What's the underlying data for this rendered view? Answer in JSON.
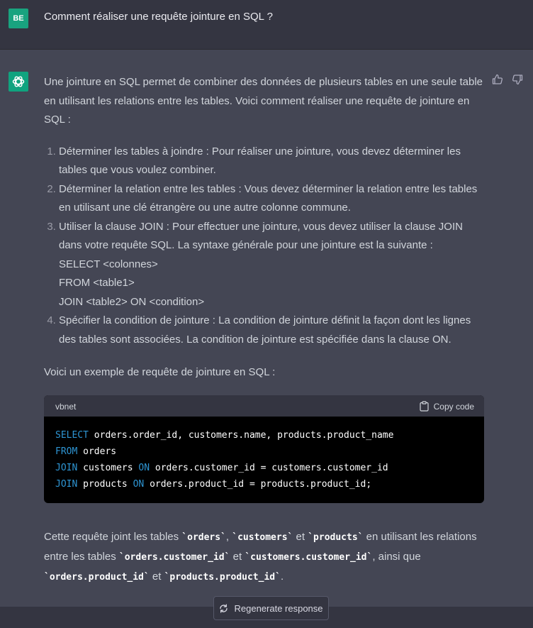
{
  "user": {
    "avatar_initials": "BE",
    "message": "Comment réaliser une requête jointure en SQL ?"
  },
  "assistant": {
    "intro": "Une jointure en SQL permet de combiner des données de plusieurs tables en une seule table en utilisant les relations entre les tables. Voici comment réaliser une requête de jointure en SQL :",
    "steps": [
      "Déterminer les tables à joindre : Pour réaliser une jointure, vous devez déterminer les tables que vous voulez combiner.",
      "Déterminer la relation entre les tables : Vous devez déterminer la relation entre les tables en utilisant une clé étrangère ou une autre colonne commune.",
      "Utiliser la clause JOIN : Pour effectuer une jointure, vous devez utiliser la clause JOIN dans votre requête SQL. La syntaxe générale pour une jointure est la suivante :",
      "Spécifier la condition de jointure : La condition de jointure définit la façon dont les lignes des tables sont associées. La condition de jointure est spécifiée dans la clause ON."
    ],
    "syntax_lines": [
      "SELECT <colonnes>",
      "FROM <table1>",
      "JOIN <table2> ON <condition>"
    ],
    "example_intro": "Voici un exemple de requête de jointure en SQL :",
    "code": {
      "language": "vbnet",
      "copy_label": "Copy code",
      "lines": [
        {
          "kw": "SELECT",
          "rest": " orders.order_id, customers.name, products.product_name"
        },
        {
          "kw": "FROM",
          "rest": " orders"
        },
        {
          "kw": "JOIN",
          "rest": " customers ",
          "kw2": "ON",
          "rest2": " orders.customer_id = customers.customer_id"
        },
        {
          "kw": "JOIN",
          "rest": " products ",
          "kw2": "ON",
          "rest2": " orders.product_id = products.product_id;"
        }
      ]
    },
    "explanation": {
      "t1": "Cette requête joint les tables ",
      "c_orders": "`orders`",
      "t2": ", ",
      "c_customers": "`customers`",
      "t3": " et ",
      "c_products": "`products`",
      "t4": " en utilisant les relations entre les tables ",
      "c_oc": "`orders.customer_id`",
      "t5": " et ",
      "c_cc": "`customers.customer_id`",
      "t6": ", ainsi que ",
      "c_op": "`orders.product_id`",
      "t7": " et ",
      "c_pp": "`products.product_id`",
      "t8": "."
    }
  },
  "regenerate_label": "Regenerate response",
  "colors": {
    "accent": "#10a37f",
    "keyword": "#2e95d3"
  }
}
